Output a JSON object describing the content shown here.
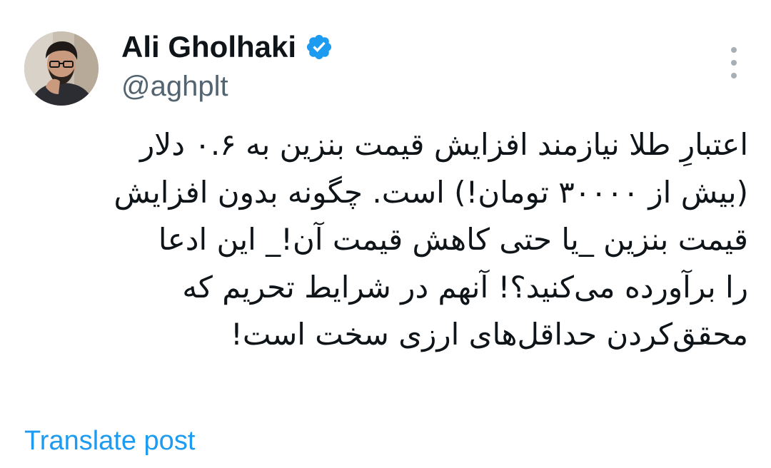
{
  "author": {
    "display_name": "Ali Gholhaki",
    "handle": "@aghplt",
    "verified": true,
    "verified_icon": "verified-badge-icon",
    "avatar_icon": "profile-photo"
  },
  "menu": {
    "icon": "more-options-icon"
  },
  "post": {
    "lines": [
      "اعتبارِ طلا نیازمند افزایش قیمت بنزین به ۰.۶ دلار",
      "(بیش از ۳۰۰۰۰ تومان!) است. چگونه بدون افزایش",
      "قیمت بنزین _یا حتی کاهش قیمت آن!_ این ادعا",
      "را برآورده می‌کنید؟! آنهم در شرایط تحریم که",
      "محقق‌کردن حداقل‌های ارزی سخت است!"
    ]
  },
  "actions": {
    "translate_label": "Translate post"
  },
  "colors": {
    "text": "#0f1419",
    "secondary": "#536471",
    "link": "#1d9bf0",
    "verified": "#1d9bf0"
  }
}
